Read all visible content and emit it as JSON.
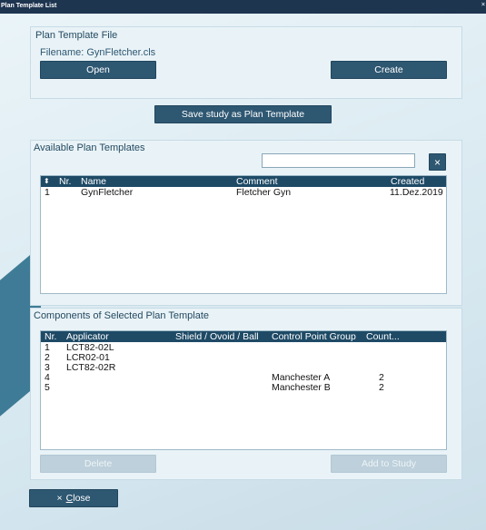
{
  "window": {
    "title": "Plan Template List",
    "close_glyph": "×"
  },
  "file_panel": {
    "title": "Plan Template File",
    "filename_label": "Filename: GynFletcher.cls",
    "open_label": "Open",
    "create_label": "Create"
  },
  "save_button_label": "Save study as Plan Template",
  "available": {
    "title": "Available Plan Templates",
    "search_value": "",
    "clear_glyph": "×",
    "headers": {
      "sort_glyph": "⬍",
      "nr": "Nr.",
      "name": "Name",
      "comment": "Comment",
      "created": "Created"
    },
    "rows": [
      {
        "nr": "1",
        "name": "GynFletcher",
        "comment": "Fletcher Gyn",
        "created": "11.Dez.2019"
      }
    ]
  },
  "components": {
    "title": "Components of Selected Plan Template",
    "headers": {
      "nr": "Nr.",
      "applicator": "Applicator",
      "shield": "Shield / Ovoid / Ball",
      "cpg": "Control Point Group",
      "count": "Count..."
    },
    "rows": [
      {
        "nr": "1",
        "applicator": "LCT82-02L",
        "shield": "",
        "cpg": "",
        "count": ""
      },
      {
        "nr": "2",
        "applicator": "LCR02-01",
        "shield": "",
        "cpg": "",
        "count": ""
      },
      {
        "nr": "3",
        "applicator": "LCT82-02R",
        "shield": "",
        "cpg": "",
        "count": ""
      },
      {
        "nr": "4",
        "applicator": "",
        "shield": "",
        "cpg": "Manchester A",
        "count": "2"
      },
      {
        "nr": "5",
        "applicator": "",
        "shield": "",
        "cpg": "Manchester B",
        "count": "2"
      }
    ],
    "delete_label": "Delete",
    "add_label": "Add to Study"
  },
  "close_button": {
    "glyph": "×",
    "underline_char": "C",
    "rest": "lose"
  },
  "colors": {
    "accent": "#2e5772",
    "header": "#1e4a66",
    "titlebar": "#1e3550"
  }
}
